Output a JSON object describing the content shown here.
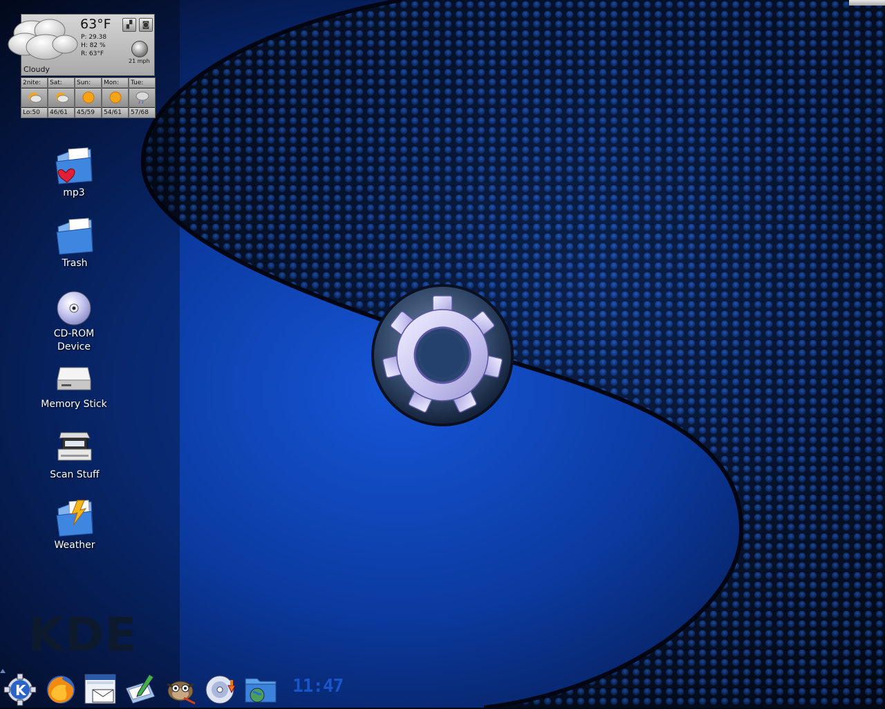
{
  "weather": {
    "temperature": "63°F",
    "pressure": "P: 29.38",
    "humidity": "H: 82 %",
    "real_feel": "R: 63°F",
    "condition": "Cloudy",
    "wind": "21 mph",
    "buttons": [
      {
        "icon": "map-icon"
      },
      {
        "icon": "camera-icon"
      }
    ],
    "forecast": [
      {
        "day": "2nite:",
        "range": "Lo:50",
        "icon": "partly-cloudy-icon"
      },
      {
        "day": "Sat:",
        "range": "46/61",
        "icon": "partly-cloudy-icon"
      },
      {
        "day": "Sun:",
        "range": "45/59",
        "icon": "sunny-icon"
      },
      {
        "day": "Mon:",
        "range": "54/61",
        "icon": "sunny-icon"
      },
      {
        "day": "Tue:",
        "range": "57/68",
        "icon": "showers-icon"
      }
    ]
  },
  "desktop_icons": [
    {
      "label": "mp3",
      "icon": "music-folder-icon"
    },
    {
      "label": "Trash",
      "icon": "trash-folder-icon"
    },
    {
      "label": "CD-ROM Device",
      "icon": "cdrom-icon"
    },
    {
      "label": "Memory Stick",
      "icon": "drive-icon"
    },
    {
      "label": "Scan Stuff",
      "icon": "scanner-icon"
    },
    {
      "label": "Weather",
      "icon": "weather-folder-icon"
    }
  ],
  "watermark": "KDE",
  "taskbar": {
    "items": [
      {
        "icon": "kde-menu-icon"
      },
      {
        "icon": "firefox-icon"
      },
      {
        "icon": "mail-client-icon"
      },
      {
        "icon": "text-editor-icon"
      },
      {
        "icon": "gimp-icon"
      },
      {
        "icon": "cd-burner-icon"
      },
      {
        "icon": "file-manager-icon"
      }
    ],
    "clock": "11:47"
  },
  "colors": {
    "wallpaper_blue": "#1146c8",
    "dark": "#02060f",
    "clock": "#1656c8"
  }
}
